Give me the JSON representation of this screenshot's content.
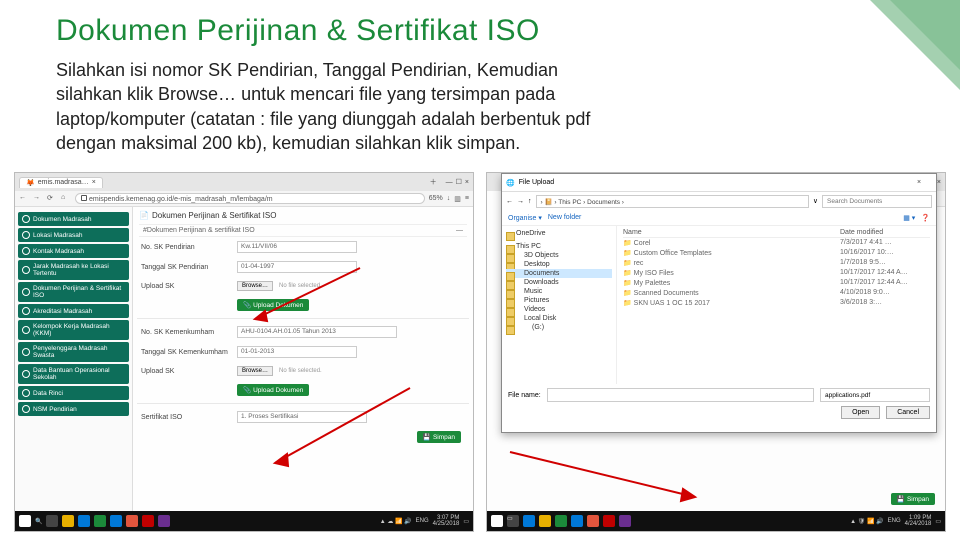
{
  "title": "Dokumen Perijinan & Sertifikat ISO",
  "description": "Silahkan isi nomor SK Pendirian, Tanggal Pendirian, Kemudian silahkan klik Browse… untuk mencari file yang tersimpan pada laptop/komputer (catatan : file yang diunggah adalah berbentuk pdf dengan maksimal 200 kb), kemudian silahkan klik simpan.",
  "browser": {
    "tab": "emis.madrasa…",
    "url": "emispendis.kemenag.go.id/e-mis_madrasah_m/lembaga/m",
    "zoom": "65%"
  },
  "sidebar": [
    "Dokumen Madrasah",
    "Lokasi Madrasah",
    "Kontak Madrasah",
    "Jarak Madrasah ke Lokasi Tertentu",
    "Dokumen Perijinan & Sertifikat ISO",
    "Akreditasi Madrasah",
    "Kelompok Kerja Madrasah (KKM)",
    "Penyelenggara Madrasah Swasta",
    "Data Bantuan Operasional Sekolah",
    "Data Rinci",
    "NSM Pendirian"
  ],
  "form": {
    "header": "Dokumen Perijinan & Sertifikat ISO",
    "subtitle": "#Dokumen Perijinan & sertifikat ISO",
    "rows": {
      "no_sk_pendirian_label": "No. SK Pendirian",
      "no_sk_pendirian_value": "Kw.11/VII/06",
      "tgl_sk_pendirian_label": "Tanggal SK Pendirian",
      "tgl_sk_pendirian_value": "01-04-1997",
      "upload_sk_label": "Upload SK",
      "browse": "Browse…",
      "no_file": "No file selected.",
      "upload_btn": "Upload Dokumen",
      "no_sk_kemenkumham_label": "No. SK Kemenkumham",
      "no_sk_kemenkumham_value": "AHU-0104.AH.01.05 Tahun 2013",
      "tgl_sk_kemenkumham_label": "Tanggal SK Kemenkumham",
      "tgl_sk_kemenkumham_value": "01-01-2013",
      "sertifikat_label": "Sertifikat ISO",
      "sertifikat_value": "1. Proses Sertifikasi"
    },
    "save": "Simpan"
  },
  "dialog": {
    "title": "File Upload",
    "crumb": "This PC  ›  Documents  ›",
    "search_placeholder": "Search Documents",
    "organise": "Organise ▾",
    "newfolder": "New folder",
    "tree": [
      "OneDrive",
      "This PC",
      "3D Objects",
      "Desktop",
      "Documents",
      "Downloads",
      "Music",
      "Pictures",
      "Videos",
      "Local Disk",
      "(G:)"
    ],
    "columns": {
      "name": "Name",
      "date": "Date modified"
    },
    "files": [
      {
        "n": "Corel",
        "d": "7/3/2017  4:41 …"
      },
      {
        "n": "Custom Office Templates",
        "d": "10/16/2017  10:…"
      },
      {
        "n": "rec",
        "d": "1/7/2018 9:5…"
      },
      {
        "n": "My ISO Files",
        "d": "10/17/2017 12:44 A…"
      },
      {
        "n": "My Palettes",
        "d": "10/17/2017 12:44 A…"
      },
      {
        "n": "Scanned Documents",
        "d": "4/10/2018 9:0…"
      },
      {
        "n": "SKN UAS 1 OC 15 2017",
        "d": "3/6/2018 3:…"
      }
    ],
    "filename_label": "File name:",
    "filetype": "applications.pdf",
    "open": "Open",
    "cancel": "Cancel"
  },
  "right_panel": {
    "save": "Simpan"
  },
  "taskbar": {
    "time1": "3:07 PM",
    "date1": "4/25/2018",
    "time2": "1:09 PM",
    "date2": "4/24/2018",
    "lang": "ENG"
  }
}
